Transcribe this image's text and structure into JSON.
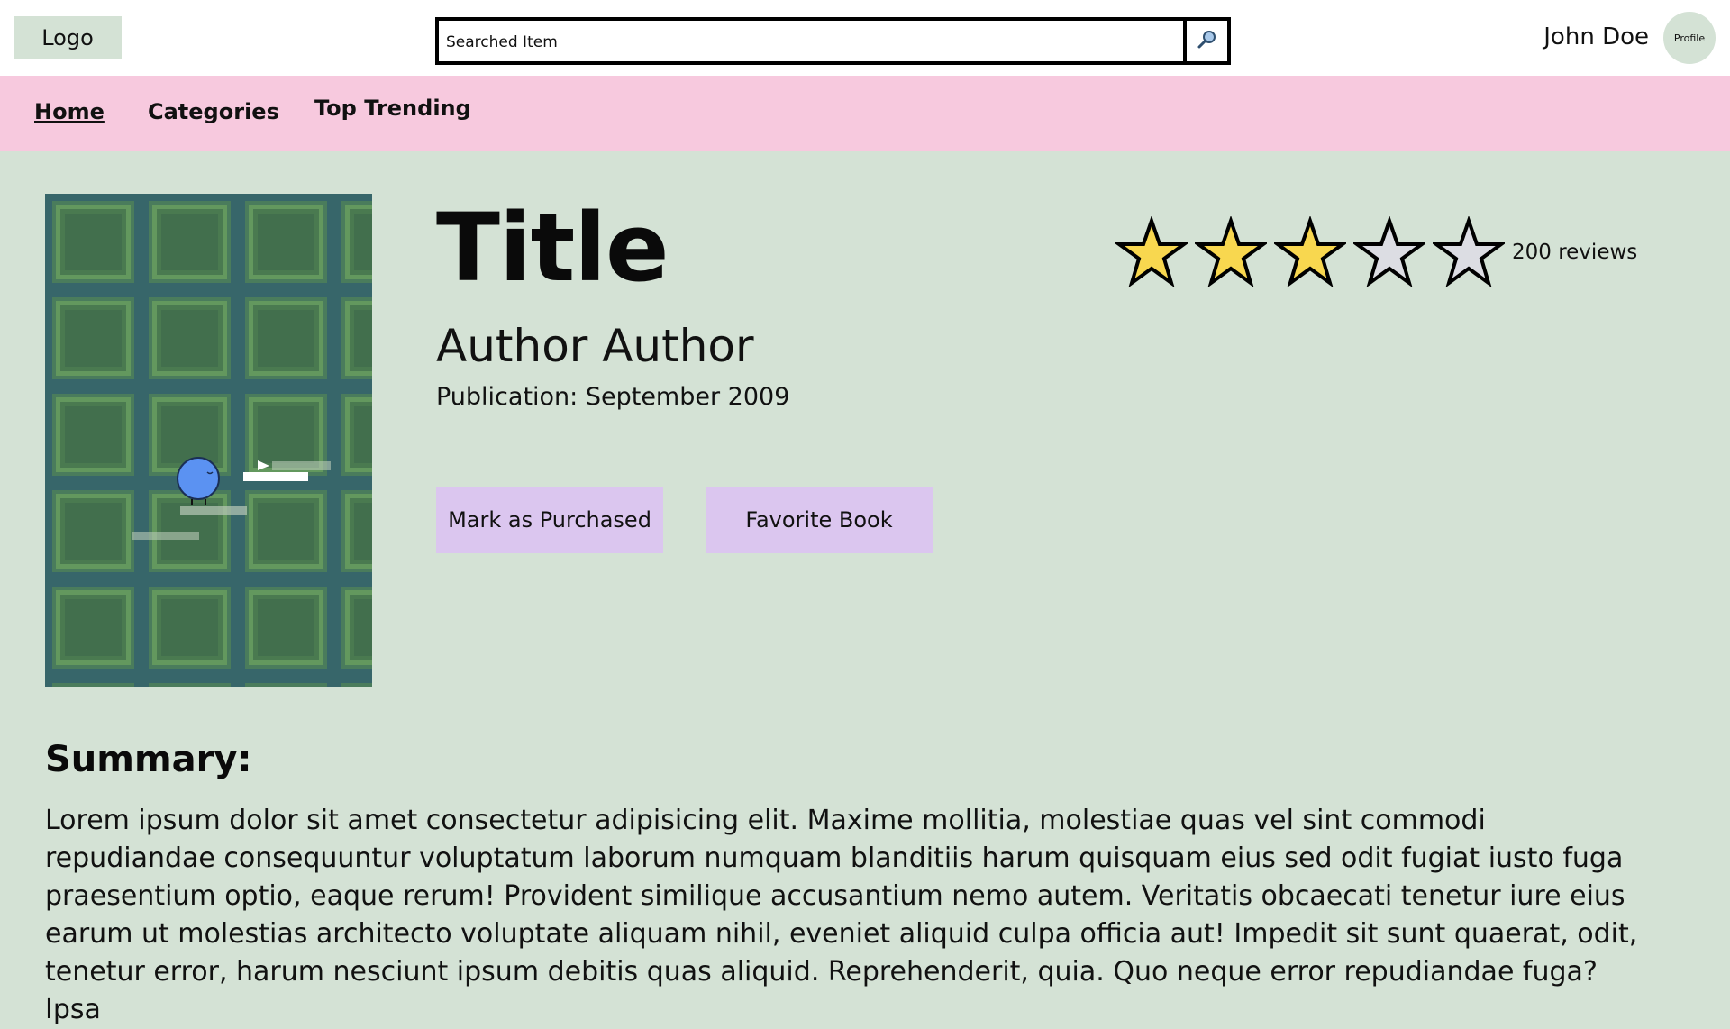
{
  "header": {
    "logo_label": "Logo",
    "search": {
      "value": "Searched Item",
      "placeholder": "Searched Item"
    },
    "search_button_icon": "search-icon",
    "user_name": "John Doe",
    "avatar_label": "Profile"
  },
  "nav": {
    "items": [
      {
        "label": "Home",
        "active": true
      },
      {
        "label": "Categories",
        "active": false
      },
      {
        "label": "Top Trending",
        "active": false
      }
    ]
  },
  "book": {
    "title": "Title",
    "author": "Author Author",
    "publication": "Publication: September 2009",
    "rating": {
      "stars_filled": 3,
      "stars_total": 5,
      "reviews_label": "200 reviews"
    },
    "cover_icon": "book-cover-image"
  },
  "actions": {
    "mark_purchased": "Mark as Purchased",
    "favorite": "Favorite Book"
  },
  "summary": {
    "heading": "Summary:",
    "text": "Lorem ipsum dolor sit amet consectetur adipisicing elit. Maxime mollitia, molestiae quas vel sint commodi repudiandae consequuntur voluptatum laborum numquam blanditiis harum quisquam eius sed odit fugiat iusto fuga praesentium optio, eaque rerum! Provident similique accusantium nemo autem. Veritatis obcaecati tenetur iure eius earum ut molestias architecto voluptate aliquam nihil, eveniet aliquid culpa officia aut! Impedit sit sunt quaerat, odit, tenetur error, harum nesciunt ipsum debitis quas aliquid. Reprehenderit, quia. Quo neque error repudiandae fuga? Ipsa"
  },
  "colors": {
    "page_bg": "#d4e2d5",
    "nav_bg": "#f7c9de",
    "button_bg": "#dbc6ef",
    "star_filled": "#f8d74f",
    "star_empty": "#dcdde3"
  }
}
